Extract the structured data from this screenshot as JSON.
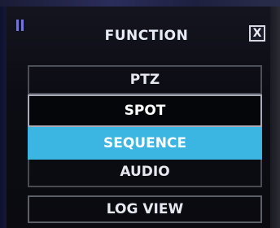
{
  "window": {
    "title": "FUNCTION",
    "close_label": "X"
  },
  "menu": {
    "items": [
      {
        "label": "PTZ"
      },
      {
        "label": "SPOT"
      },
      {
        "label": "SEQUENCE"
      },
      {
        "label": "AUDIO"
      },
      {
        "label": "LOG VIEW"
      }
    ],
    "selected": "SEQUENCE"
  },
  "colors": {
    "accent": "#3bb5e2",
    "background": "#0a0b12",
    "text": "#e6e8ef"
  },
  "icons": {
    "grip": "grip-icon",
    "close": "close-icon"
  }
}
